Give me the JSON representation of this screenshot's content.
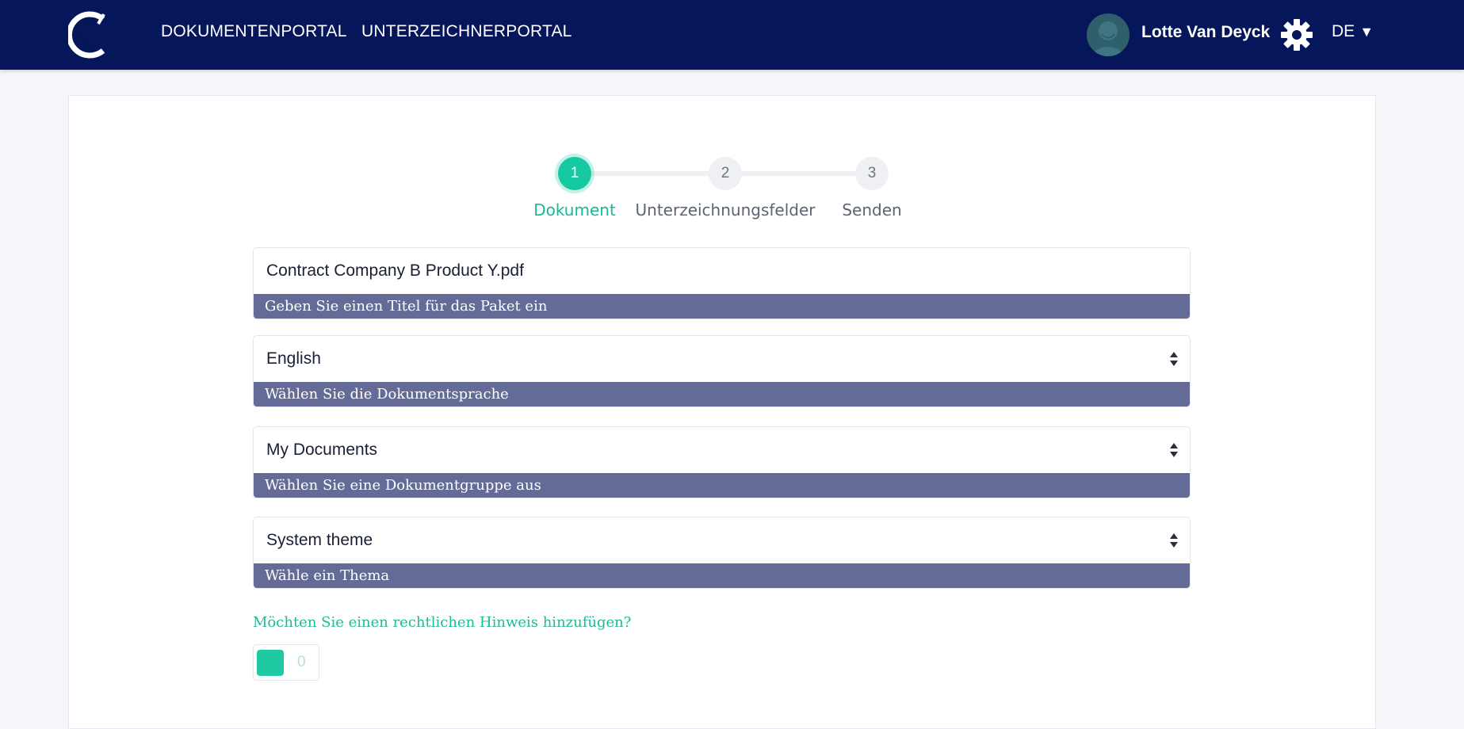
{
  "header": {
    "nav": [
      {
        "label": "DOKUMENTENPORTAL"
      },
      {
        "label": "UNTERZEICHNERPORTAL"
      }
    ],
    "user_name": "Lotte Van Deyck",
    "language": "DE",
    "language_caret": "▼"
  },
  "stepper": {
    "steps": [
      {
        "number": "1",
        "label": "Dokument",
        "active": true
      },
      {
        "number": "2",
        "label": "Unterzeichnungsfelder",
        "active": false
      },
      {
        "number": "3",
        "label": "Senden",
        "active": false
      }
    ]
  },
  "form": {
    "title_field": {
      "value": "Contract Company B Product Y.pdf",
      "hint": "Geben Sie einen Titel für das Paket ein"
    },
    "language_field": {
      "value": "English",
      "hint": "Wählen Sie die Dokumentsprache"
    },
    "group_field": {
      "value": "My Documents",
      "hint": "Wählen Sie eine Dokumentgruppe aus"
    },
    "theme_field": {
      "value": "System theme",
      "hint": "Wähle ein Thema"
    },
    "legal_notice_question": "Möchten Sie einen rechtlichen Hinweis hinzufügen?",
    "legal_notice_toggle_label": "0"
  },
  "colors": {
    "header_bg": "#05175a",
    "accent": "#17c9a2",
    "hint_bg": "#636b96"
  }
}
